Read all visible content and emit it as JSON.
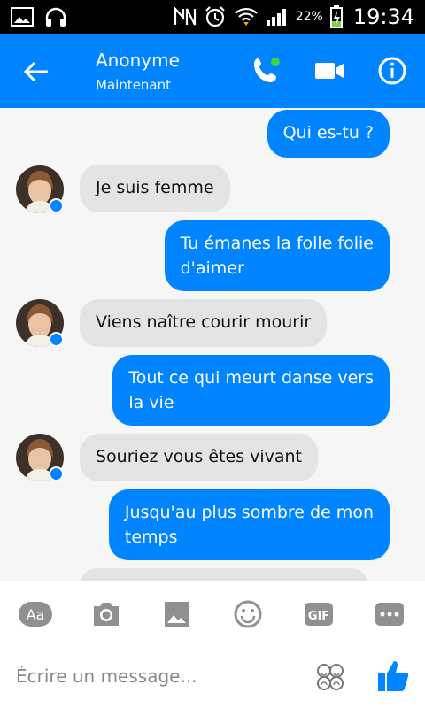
{
  "status_bar": {
    "battery_percent": "22%",
    "time": "19:34"
  },
  "header": {
    "contact_name": "Anonyme",
    "status": "Maintenant"
  },
  "messages": [
    {
      "text": "Qui es-tu ?",
      "type": "sent"
    },
    {
      "text": "Je suis femme",
      "type": "received"
    },
    {
      "text": "Tu émanes la folle folie",
      "text2": "d'aimer",
      "type": "sent"
    },
    {
      "text": "Viens naître courir mourir",
      "type": "received"
    },
    {
      "text": "Tout ce qui meurt danse vers",
      "text2": "la vie",
      "type": "sent"
    },
    {
      "text": "Souriez vous êtes vivant",
      "type": "received"
    },
    {
      "text": "Jusqu'au plus sombre de mon",
      "text2": "temps",
      "type": "sent"
    }
  ],
  "toolbar": {
    "aa_label": "Aa",
    "gif_label": "GIF"
  },
  "composer": {
    "placeholder": "Écrire un message..."
  },
  "colors": {
    "accent": "#0084ff",
    "received_bubble": "#e4e4e4",
    "background": "#f6f6f6"
  }
}
